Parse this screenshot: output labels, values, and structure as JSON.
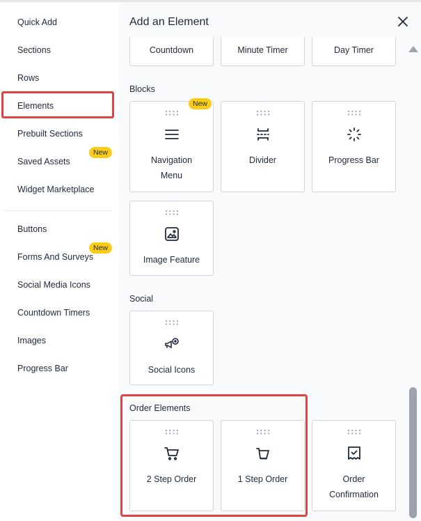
{
  "sidebar": {
    "items": [
      {
        "label": "Quick Add"
      },
      {
        "label": "Sections"
      },
      {
        "label": "Rows"
      },
      {
        "label": "Elements"
      },
      {
        "label": "Prebuilt Sections"
      },
      {
        "label": "Saved Assets",
        "badge": "New"
      },
      {
        "label": "Widget Marketplace"
      },
      {
        "label": "Buttons"
      },
      {
        "label": "Forms And Surveys",
        "badge": "New"
      },
      {
        "label": "Social Media Icons"
      },
      {
        "label": "Countdown Timers"
      },
      {
        "label": "Images"
      },
      {
        "label": "Progress Bar"
      }
    ],
    "active": "Elements"
  },
  "panel": {
    "title": "Add an Element",
    "close_icon": "close-icon"
  },
  "timers": {
    "cards": [
      {
        "label": "Countdown"
      },
      {
        "label": "Minute Timer"
      },
      {
        "label": "Day Timer"
      }
    ]
  },
  "blocks": {
    "heading": "Blocks",
    "cards": [
      {
        "label_line1": "Navigation",
        "label_line2": "Menu",
        "icon": "menu-icon",
        "badge": "New"
      },
      {
        "label": "Divider",
        "icon": "divider-icon"
      },
      {
        "label": "Progress Bar",
        "icon": "loader-icon"
      },
      {
        "label": "Image Feature",
        "icon": "image-icon"
      }
    ]
  },
  "social": {
    "heading": "Social",
    "cards": [
      {
        "label": "Social Icons",
        "icon": "social-icon"
      }
    ]
  },
  "order": {
    "heading": "Order Elements",
    "cards": [
      {
        "label": "2 Step Order",
        "icon": "cart-icon"
      },
      {
        "label": "1 Step Order",
        "icon": "basket-icon"
      },
      {
        "label_line1": "Order",
        "label_line2": "Confirmation",
        "icon": "receipt-check-icon"
      }
    ]
  },
  "colors": {
    "highlight": "#e04343",
    "badge": "#facc15"
  }
}
